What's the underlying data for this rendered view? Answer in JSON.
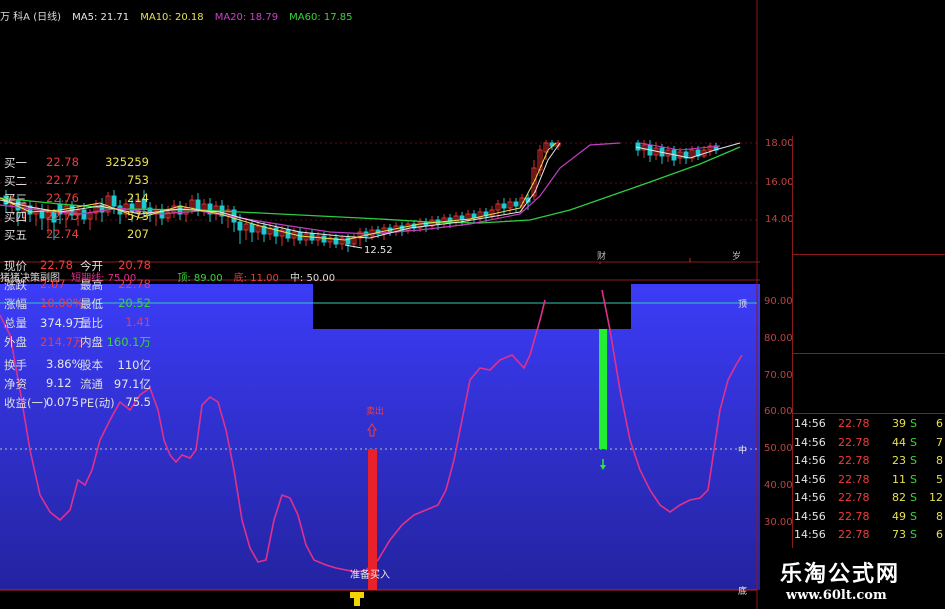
{
  "header": {
    "stock": "万 科A (日线)",
    "ma5": "MA5: 21.71",
    "ma10": "MA10: 20.18",
    "ma20": "MA20: 18.79",
    "ma60": "MA60: 17.85"
  },
  "price_axis": {
    "ticks": [
      "18.00",
      "16.00",
      "14.00"
    ]
  },
  "price_chart": {
    "low_label": "12.52",
    "marker_cai": "财",
    "marker_sui": "岁"
  },
  "indicator": {
    "title": "猪猪决策副图",
    "line1": "短期线: 75.00",
    "line2": "顶: 89.00",
    "line3": "底: 11.00",
    "line4": "中: 50.00",
    "axis_ticks": [
      "90.00",
      "80.00",
      "70.00",
      "60.00",
      "50.00",
      "40.00",
      "30.00"
    ],
    "tag_top": "顶",
    "tag_mid": "中",
    "tag_bottom": "底",
    "sell_label": "卖出",
    "buy_label": "准备买入"
  },
  "colors": {
    "background": "#000000",
    "indicator_bg_top": "#3a3af5",
    "indicator_bg_bottom": "#2525a8",
    "curve": "#e0308c",
    "up": "#f03c3c",
    "down": "#3bd43b",
    "ma20": "#c040c0",
    "ma60": "#2ecc40"
  },
  "quote": {
    "order_book": [
      {
        "name": "买一",
        "price": "22.78",
        "vol": "325259"
      },
      {
        "name": "买二",
        "price": "22.77",
        "vol": "753"
      },
      {
        "name": "买三",
        "price": "22.76",
        "vol": "214"
      },
      {
        "name": "买四",
        "price": "22.75",
        "vol": "573"
      },
      {
        "name": "买五",
        "price": "22.74",
        "vol": "207"
      }
    ],
    "stats": [
      {
        "l1": "现价",
        "v1": "22.78",
        "l2": "今开",
        "v2": "20.78"
      },
      {
        "l1": "涨跌",
        "v1": "2.07",
        "l2": "最高",
        "v2": "22.78"
      },
      {
        "l1": "涨幅",
        "v1": "10.00%",
        "l2": "最低",
        "v2": "20.52"
      },
      {
        "l1": "总量",
        "v1": "374.9万",
        "l2": "量比",
        "v2": "1.41"
      },
      {
        "l1": "外盘",
        "v1": "214.7万",
        "l2": "内盘",
        "v2": "160.1万"
      }
    ],
    "fundamentals": [
      {
        "l1": "换手",
        "v1": "3.86%",
        "l2": "股本",
        "v2": "110亿"
      },
      {
        "l1": "净资",
        "v1": "9.12",
        "l2": "流通",
        "v2": "97.1亿"
      },
      {
        "l1": "收益(一)",
        "v1": "0.075",
        "l2": "PE(动)",
        "v2": "75.5"
      }
    ],
    "ticks": [
      {
        "time": "14:56",
        "price": "22.78",
        "vol": "39",
        "side": "S",
        "n": "6"
      },
      {
        "time": "14:56",
        "price": "22.78",
        "vol": "44",
        "side": "S",
        "n": "7"
      },
      {
        "time": "14:56",
        "price": "22.78",
        "vol": "23",
        "side": "S",
        "n": "8"
      },
      {
        "time": "14:56",
        "price": "22.78",
        "vol": "11",
        "side": "S",
        "n": "5"
      },
      {
        "time": "14:56",
        "price": "22.78",
        "vol": "82",
        "side": "S",
        "n": "12"
      },
      {
        "time": "14:56",
        "price": "22.78",
        "vol": "49",
        "side": "S",
        "n": "8"
      },
      {
        "time": "14:56",
        "price": "22.78",
        "vol": "73",
        "side": "S",
        "n": "6"
      }
    ]
  },
  "watermark": {
    "title": "乐淘公式网",
    "url": "www.60lt.com"
  }
}
